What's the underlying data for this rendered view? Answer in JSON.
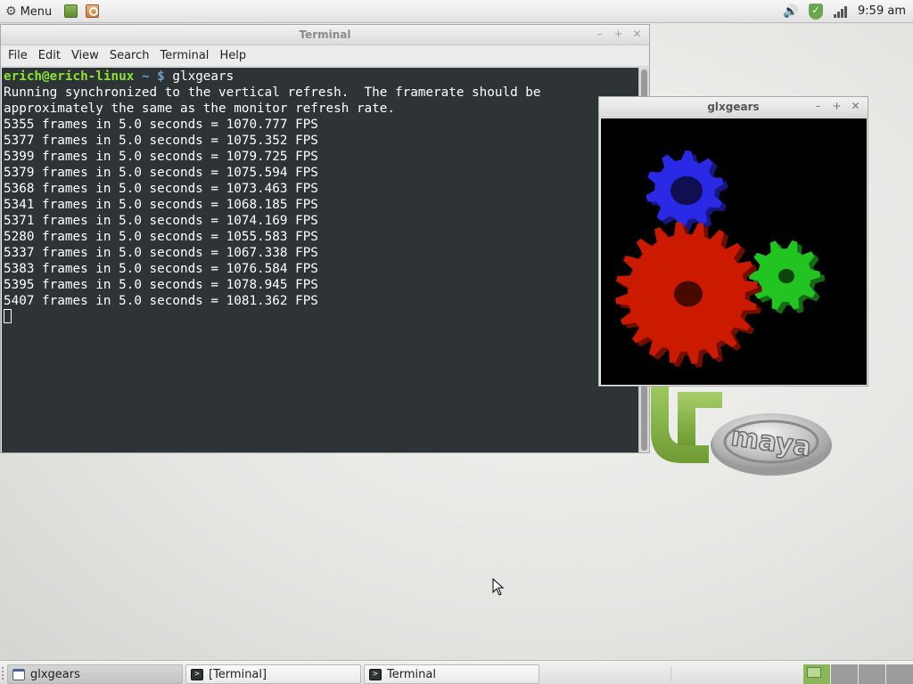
{
  "top_panel": {
    "menu_label": "Menu",
    "clock": "9:59 am",
    "icons": [
      "gear-icon",
      "files-icon",
      "search-icon",
      "volume-icon",
      "update-shield-icon",
      "network-icon"
    ]
  },
  "terminal_window": {
    "title": "Terminal",
    "menu": [
      "File",
      "Edit",
      "View",
      "Search",
      "Terminal",
      "Help"
    ],
    "prompt_user": "erich@erich-linux",
    "prompt_path": "~ $",
    "command": "glxgears",
    "output": [
      "Running synchronized to the vertical refresh.  The framerate should be",
      "approximately the same as the monitor refresh rate.",
      "5355 frames in 5.0 seconds = 1070.777 FPS",
      "5377 frames in 5.0 seconds = 1075.352 FPS",
      "5399 frames in 5.0 seconds = 1079.725 FPS",
      "5379 frames in 5.0 seconds = 1075.594 FPS",
      "5368 frames in 5.0 seconds = 1073.463 FPS",
      "5341 frames in 5.0 seconds = 1068.185 FPS",
      "5371 frames in 5.0 seconds = 1074.169 FPS",
      "5280 frames in 5.0 seconds = 1055.583 FPS",
      "5337 frames in 5.0 seconds = 1067.338 FPS",
      "5383 frames in 5.0 seconds = 1076.584 FPS",
      "5395 frames in 5.0 seconds = 1078.945 FPS",
      "5407 frames in 5.0 seconds = 1081.362 FPS"
    ]
  },
  "glxgears_window": {
    "title": "glxgears",
    "gear_colors": {
      "red": "#cc1a00",
      "green": "#22c422",
      "blue": "#2a2ae6"
    }
  },
  "desktop": {
    "logo_text": "maya"
  },
  "taskbar": {
    "tasks": [
      {
        "label": "glxgears",
        "icon": "window-icon",
        "active": true
      },
      {
        "label": "[Terminal]",
        "icon": "terminal-icon",
        "active": false
      },
      {
        "label": "Terminal",
        "icon": "terminal-icon",
        "active": false
      }
    ],
    "workspace_count": 4
  },
  "colors": {
    "terminal_bg": "#2e3436",
    "prompt_user": "#8ae234",
    "prompt_path": "#729fcf",
    "workspace_active": "#8ab55a"
  }
}
